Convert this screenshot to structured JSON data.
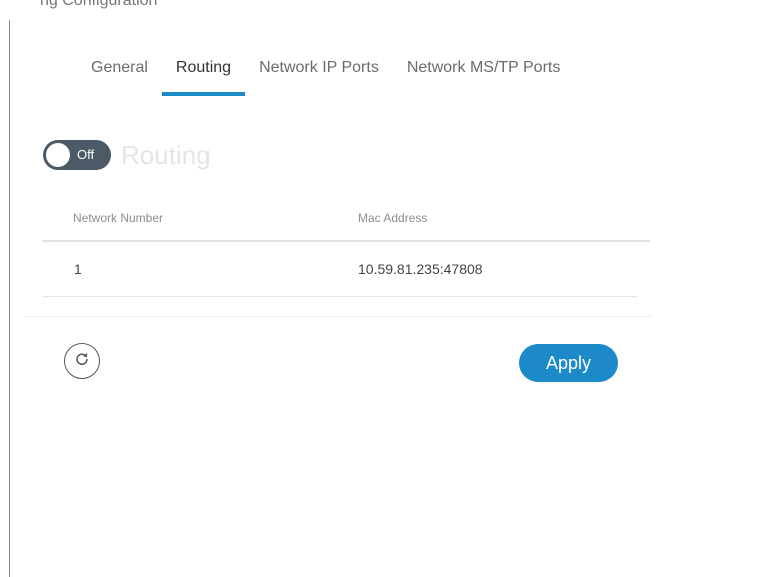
{
  "header_fragment": "ng Configuration",
  "tabs": [
    {
      "label": "General"
    },
    {
      "label": "Routing"
    },
    {
      "label": "Network IP Ports"
    },
    {
      "label": "Network MS/TP Ports"
    }
  ],
  "active_tab": "Routing",
  "routing": {
    "toggle_state": "Off",
    "title": "Routing"
  },
  "table": {
    "headers": {
      "network_number": "Network Number",
      "mac_address": "Mac Address"
    },
    "rows": [
      {
        "network_number": "1",
        "mac_address": "10.59.81.235:47808"
      }
    ]
  },
  "actions": {
    "refresh_icon": "refresh-icon",
    "apply_label": "Apply"
  },
  "colors": {
    "accent": "#1c8ac9",
    "toggle_off": "#4b5a66"
  }
}
